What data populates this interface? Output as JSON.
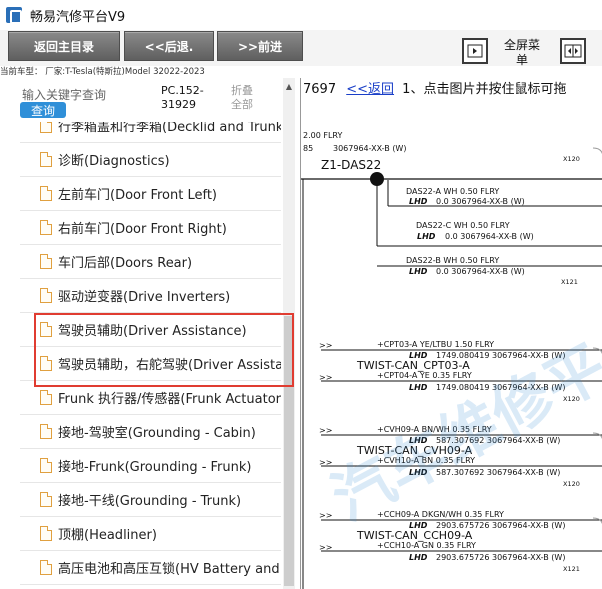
{
  "app": {
    "title": "畅易汽修平台V9"
  },
  "toolbar": {
    "home_label": "返回主目录",
    "back_label": "<<后退.",
    "forward_label": ">>前进",
    "fullscreen_label": "全屏菜单"
  },
  "car_info": "当前车型：  厂家:T-Tesla(特斯拉)Model 32022-2023",
  "search": {
    "label": "输入关键字查询",
    "query_button": "查询"
  },
  "doc": {
    "code": "PC.152-31929",
    "collapse_all": "折叠全部"
  },
  "tree": {
    "items": [
      {
        "label": "行李箱盖和行李箱(Decklid and Trunk"
      },
      {
        "label": "诊断(Diagnostics)"
      },
      {
        "label": "左前车门(Door Front Left)"
      },
      {
        "label": "右前车门(Door Front Right)"
      },
      {
        "label": "车门后部(Doors Rear)"
      },
      {
        "label": "驱动逆变器(Drive Inverters)"
      },
      {
        "label": "驾驶员辅助(Driver Assistance)"
      },
      {
        "label": "驾驶员辅助，右舵驾驶(Driver Assistar"
      },
      {
        "label": "Frunk 执行器/传感器(Frunk Actuator,"
      },
      {
        "label": "接地-驾驶室(Grounding - Cabin)"
      },
      {
        "label": "接地-Frunk(Grounding - Frunk)"
      },
      {
        "label": "接地-干线(Grounding - Trunk)"
      },
      {
        "label": "顶棚(Headliner)"
      },
      {
        "label": "高压电池和高压互锁(HV Battery and"
      }
    ]
  },
  "header": {
    "number": "7697",
    "back_link": "<<返回",
    "instruction": "1、点击图片并按住鼠标可拖"
  },
  "diagram": {
    "top_code": "2.00   FLRY",
    "top_part": "3067964-XX-B (W)",
    "top_num": "85",
    "node_label": "Z1-DAS22",
    "x120": "X120",
    "x121": "X121",
    "wires": [
      {
        "line1": "DAS22-A    WH    0.50    FLRY",
        "line2_tag": "LHD",
        "line2": "0.0     3067964-XX-B (W)"
      },
      {
        "line1": "DAS22-C    WH    0.50    FLRY",
        "line2_tag": "LHD",
        "line2": "0.0     3067964-XX-B (W)"
      },
      {
        "line1": "DAS22-B    WH    0.50    FLRY",
        "line2_tag": "LHD",
        "line2": "0.0     3067964-XX-B (W)"
      }
    ],
    "twists": [
      {
        "a1": "+CPT03-A    YE/LTBU    1.50    FLRY",
        "a2_tag": "LHD",
        "a2": "1749.080419    3067964-XX-B (W)",
        "name": "TWIST-CAN_CPT03-A",
        "b1": "+CPT04-A    YE    0.35    FLRY",
        "b2_tag": "LHD",
        "b2": "1749.080419    3067964-XX-B (W)",
        "x": "X120"
      },
      {
        "a1": "+CVH09-A    BN/WH    0.35    FLRY",
        "a2_tag": "LHD",
        "a2": "587.307692    3067964-XX-B (W)",
        "name": "TWIST-CAN_CVH09-A",
        "b1": "+CVH10-A    BN    0.35    FLRY",
        "b2_tag": "LHD",
        "b2": "587.307692    3067964-XX-B (W)",
        "x": "X120"
      },
      {
        "a1": "+CCH09-A    DKGN/WH    0.35    FLRY",
        "a2_tag": "LHD",
        "a2": "2903.675726    3067964-XX-B (W)",
        "name": "TWIST-CAN_CCH09-A",
        "b1": "+CCH10-A    GN    0.35    FLRY",
        "b2_tag": "LHD",
        "b2": "2903.675726    3067964-XX-B (W)",
        "x": "X121"
      }
    ]
  }
}
